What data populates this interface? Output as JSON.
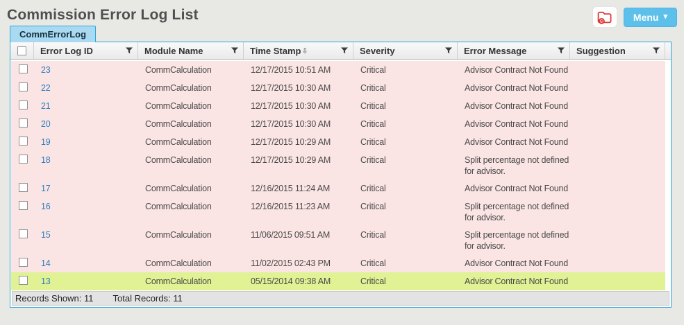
{
  "page": {
    "title": "Commission Error Log List"
  },
  "topbar": {
    "menu_label": "Menu",
    "menu_caret": "▾"
  },
  "colors": {
    "accent_blue": "#2ba6d9",
    "menu_button_blue": "#5cc0ea",
    "tab_fill": "#aadaf1",
    "row_pink": "#fbe4e4",
    "row_highlight_green": "#e0f294",
    "link_blue": "#2c7fbe",
    "icon_red": "#dc3a38"
  },
  "tabs": [
    {
      "label": "CommErrorLog",
      "active": true
    }
  ],
  "table": {
    "columns": [
      {
        "label": "Error Log ID"
      },
      {
        "label": "Module Name"
      },
      {
        "label": "Time Stamp",
        "sort_icon": "⇩"
      },
      {
        "label": "Severity"
      },
      {
        "label": "Error Message"
      },
      {
        "label": "Suggestion"
      }
    ],
    "rows": [
      {
        "id": "23",
        "module": "CommCalculation",
        "timestamp": "12/17/2015 10:51 AM",
        "severity": "Critical",
        "message": "Advisor Contract Not Found",
        "suggestion": "",
        "highlighted": false
      },
      {
        "id": "22",
        "module": "CommCalculation",
        "timestamp": "12/17/2015 10:30 AM",
        "severity": "Critical",
        "message": "Advisor Contract Not Found",
        "suggestion": "",
        "highlighted": false
      },
      {
        "id": "21",
        "module": "CommCalculation",
        "timestamp": "12/17/2015 10:30 AM",
        "severity": "Critical",
        "message": "Advisor Contract Not Found",
        "suggestion": "",
        "highlighted": false
      },
      {
        "id": "20",
        "module": "CommCalculation",
        "timestamp": "12/17/2015 10:30 AM",
        "severity": "Critical",
        "message": "Advisor Contract Not Found",
        "suggestion": "",
        "highlighted": false
      },
      {
        "id": "19",
        "module": "CommCalculation",
        "timestamp": "12/17/2015 10:29 AM",
        "severity": "Critical",
        "message": "Advisor Contract Not Found",
        "suggestion": "",
        "highlighted": false
      },
      {
        "id": "18",
        "module": "CommCalculation",
        "timestamp": "12/17/2015 10:29 AM",
        "severity": "Critical",
        "message": "Split percentage not defined for advisor.",
        "suggestion": "",
        "highlighted": false
      },
      {
        "id": "17",
        "module": "CommCalculation",
        "timestamp": "12/16/2015 11:24 AM",
        "severity": "Critical",
        "message": "Advisor Contract Not Found",
        "suggestion": "",
        "highlighted": false
      },
      {
        "id": "16",
        "module": "CommCalculation",
        "timestamp": "12/16/2015 11:23 AM",
        "severity": "Critical",
        "message": "Split percentage not defined for advisor.",
        "suggestion": "",
        "highlighted": false
      },
      {
        "id": "15",
        "module": "CommCalculation",
        "timestamp": "11/06/2015 09:51 AM",
        "severity": "Critical",
        "message": "Split percentage not defined for advisor.",
        "suggestion": "",
        "highlighted": false
      },
      {
        "id": "14",
        "module": "CommCalculation",
        "timestamp": "11/02/2015 02:43 PM",
        "severity": "Critical",
        "message": "Advisor Contract Not Found",
        "suggestion": "",
        "highlighted": false
      },
      {
        "id": "13",
        "module": "CommCalculation",
        "timestamp": "05/15/2014 09:38 AM",
        "severity": "Critical",
        "message": "Advisor Contract Not Found",
        "suggestion": "",
        "highlighted": true
      }
    ]
  },
  "footer": {
    "records_shown": "Records Shown: 11",
    "total_records": "Total Records: 11"
  }
}
